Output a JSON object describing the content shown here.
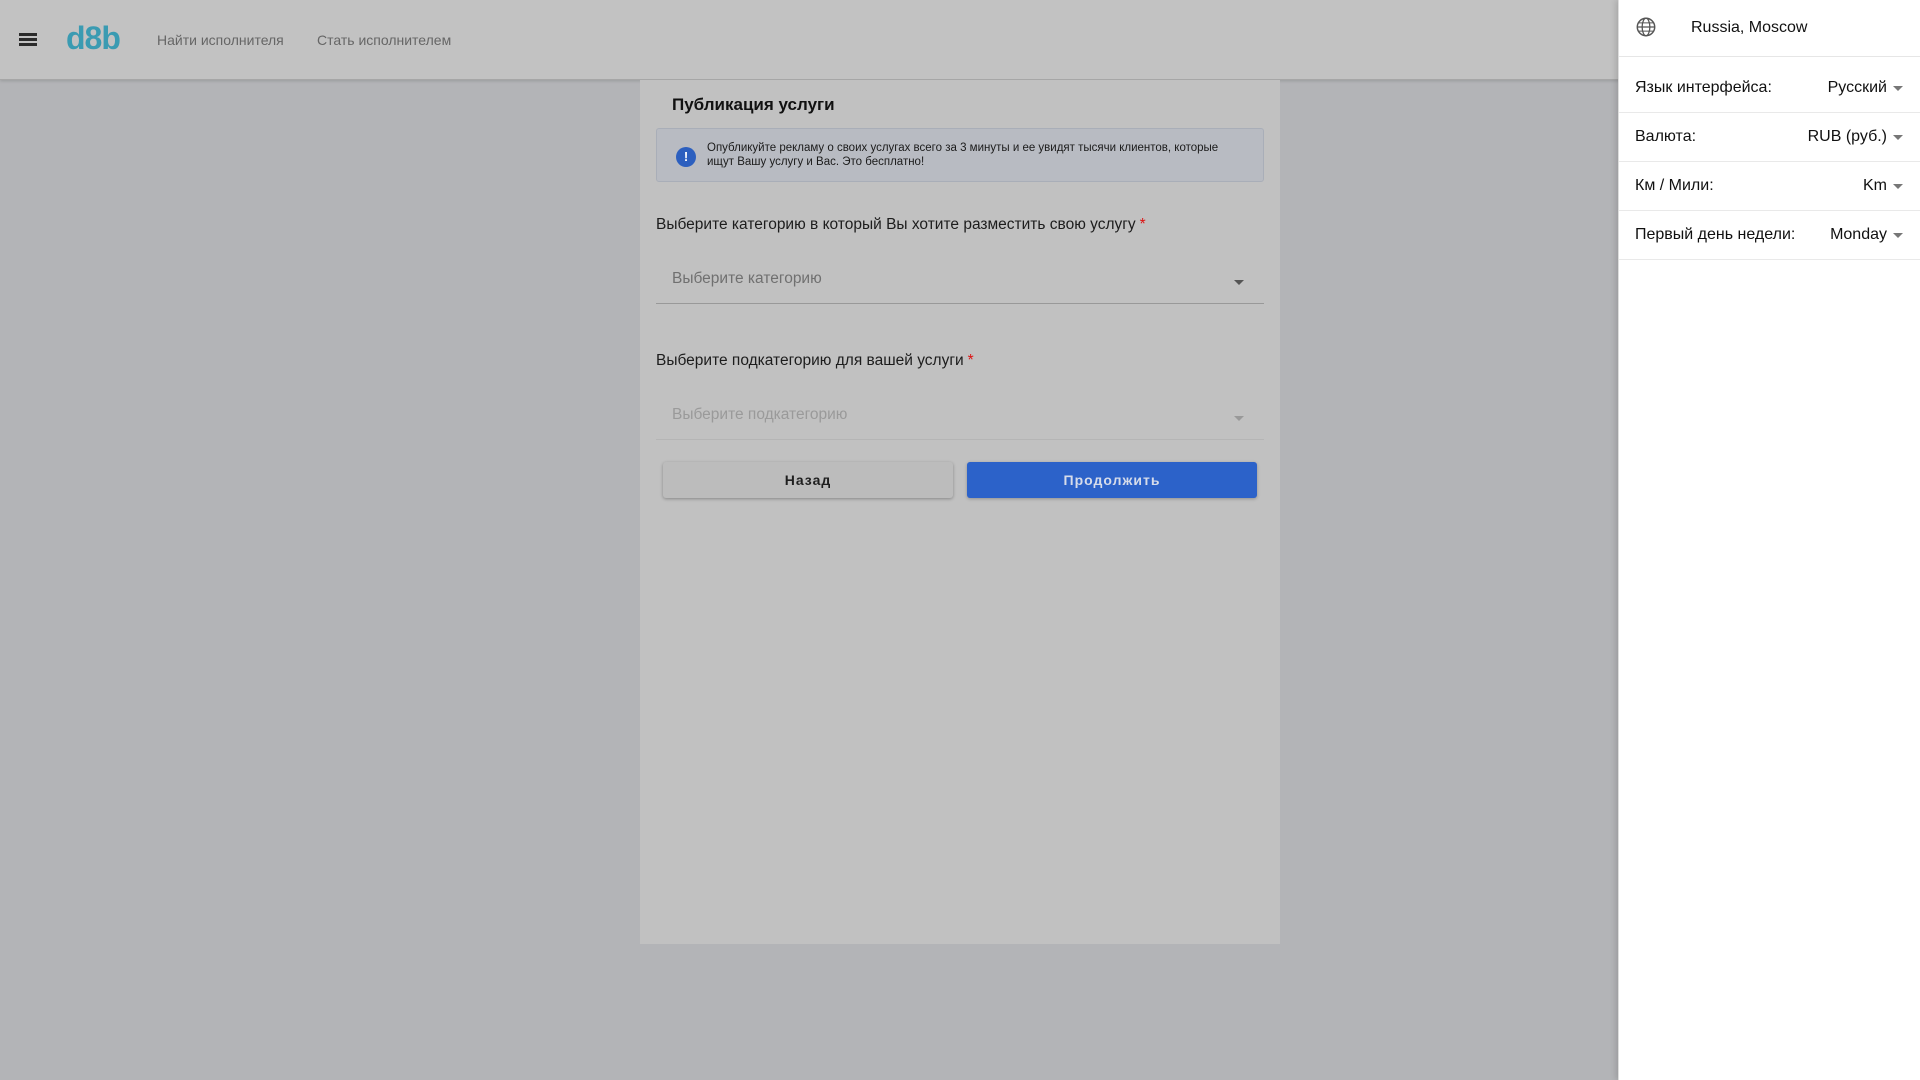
{
  "header": {
    "logo": "d8b",
    "nav": [
      "Найти исполнителя",
      "Стать исполнителем"
    ]
  },
  "card": {
    "title": "Публикация услуги",
    "alert_icon": "!",
    "alert_text": "Опубликуйте рекламу о своих услугах всего за 3 минуты и ее увидят тысячи клиентов, которые ищут Вашу услугу и Вас. Это бесплатно!",
    "category_label": "Выберите категорию в который Вы хотите разместить свою услугу",
    "category_placeholder": "Выберите категорию",
    "subcategory_label": "Выберите подкатегорию для вашей услуги",
    "subcategory_placeholder": "Выберите подкатегорию",
    "required_mark": "*",
    "back_label": "Назад",
    "continue_label": "Продолжить"
  },
  "drawer": {
    "location": "Russia, Moscow",
    "settings": [
      {
        "label": "Язык интерфейса:",
        "value": "Русский"
      },
      {
        "label": "Валюта:",
        "value": "RUB (руб.)"
      },
      {
        "label": "Км / Мили:",
        "value": "Km"
      },
      {
        "label": "Первый день недели:",
        "value": "Monday"
      }
    ]
  },
  "colors": {
    "logo": "#3a9bb2",
    "primary_button": "#2c62c9",
    "required": "#dd1111"
  },
  "icons": [
    "menu-icon",
    "info-icon",
    "chevron-down-icon",
    "globe-icon"
  ]
}
